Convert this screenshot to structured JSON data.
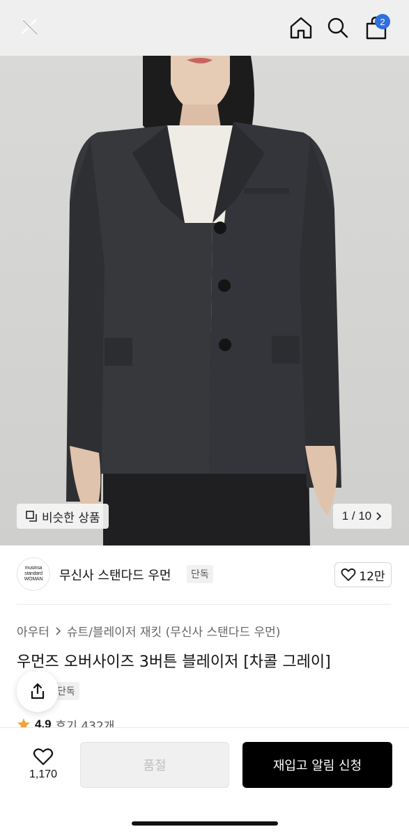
{
  "header": {
    "close_icon": "close-icon",
    "home_icon": "home-icon",
    "search_icon": "search-icon",
    "cart_icon": "shopping-bag-icon",
    "cart_count": "2",
    "badge_color": "#2f6fe0"
  },
  "hero": {
    "similar_label": "비슷한 상품",
    "pager": "1 / 10"
  },
  "brand": {
    "logo_line1": "musinsa",
    "logo_line2": "standard",
    "logo_line3": "WOMAN",
    "name": "무신사 스탠다드 우먼",
    "tag": "단독",
    "likes": "12만"
  },
  "product": {
    "breadcrumb": [
      "아우터",
      "슈트/블레이저 재킷 (무신사 스탠다드 우먼)"
    ],
    "title": "우먼즈 오버사이즈 3버튼 블레이저 [차콜 그레이]",
    "tag": "단독",
    "rating": "4.9",
    "reviews": "후기 432개"
  },
  "bottom_bar": {
    "wish_count": "1,170",
    "soldout_label": "품절",
    "restock_label": "재입고 알림 신청"
  }
}
